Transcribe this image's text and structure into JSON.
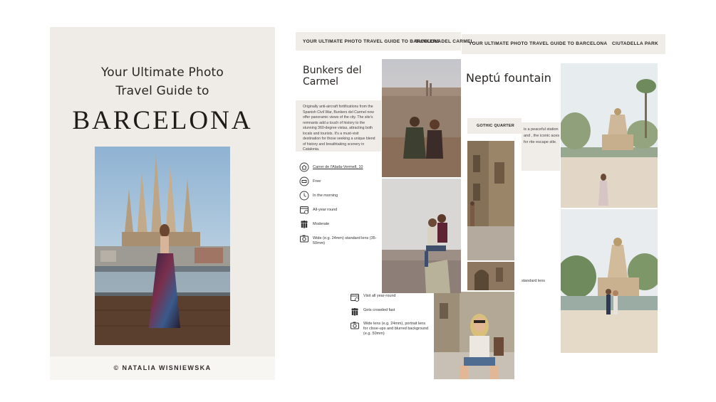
{
  "cover": {
    "subtitle_line1": "Your Ultimate Photo",
    "subtitle_line2": "Travel Guide to",
    "title": "BARCELONA",
    "author": "© NATALIA WISNIEWSKA"
  },
  "page_park": {
    "header_left": "YOUR ULTIMATE PHOTO TRAVEL GUIDE TO BARCELONA",
    "header_right": "CIUTADELLA PARK",
    "title": "Neptú fountain",
    "description_partial": "is a peaceful station and , the iconic aces for rite escape stle.",
    "lens_partial": "standard lens"
  },
  "page_gothic": {
    "label": "GOTHIC QUARTER",
    "info": [
      {
        "icon": "calendar-icon",
        "text": "Visit all year-round"
      },
      {
        "icon": "crowd-icon",
        "text": "Gets crowded fast"
      },
      {
        "icon": "camera-icon",
        "text": "Wide lens (e.g. 24mm), portrait lens for close-ups and blurred background (e.g. 50mm)"
      }
    ]
  },
  "page_bunkers": {
    "header_left": "YOUR ULTIMATE PHOTO TRAVEL GUIDE TO BARCELONA",
    "header_right": "BUNKERS DEL CARMEL",
    "title": "Bunkers del Carmel",
    "description": "Originally anti-aircraft fortifications from the Spanish Civil War, Bunkers del Carmel now offer panoramic views of the city. The site's remnants add a touch of history to the stunning 360-degree vistas, attracting both locals and tourists. It's a must-visit destination for those seeking a unique blend of history and breathtaking scenery in Catalonia.",
    "info": [
      {
        "icon": "home-icon",
        "text": "Carrer de l'Alada-Vermell, 10"
      },
      {
        "icon": "ticket-icon",
        "text": "Free"
      },
      {
        "icon": "clock-icon",
        "text": "In the morning"
      },
      {
        "icon": "calendar-icon",
        "text": "All-year round"
      },
      {
        "icon": "crowd-icon",
        "text": "Moderate"
      },
      {
        "icon": "camera-icon",
        "text": "Wide (e.g. 24mm) standard lens (35-50mm)"
      }
    ]
  },
  "colors": {
    "cover_bg": "#efebe6",
    "panel_bg": "#f0ede9",
    "text_dark": "#2a2624"
  }
}
